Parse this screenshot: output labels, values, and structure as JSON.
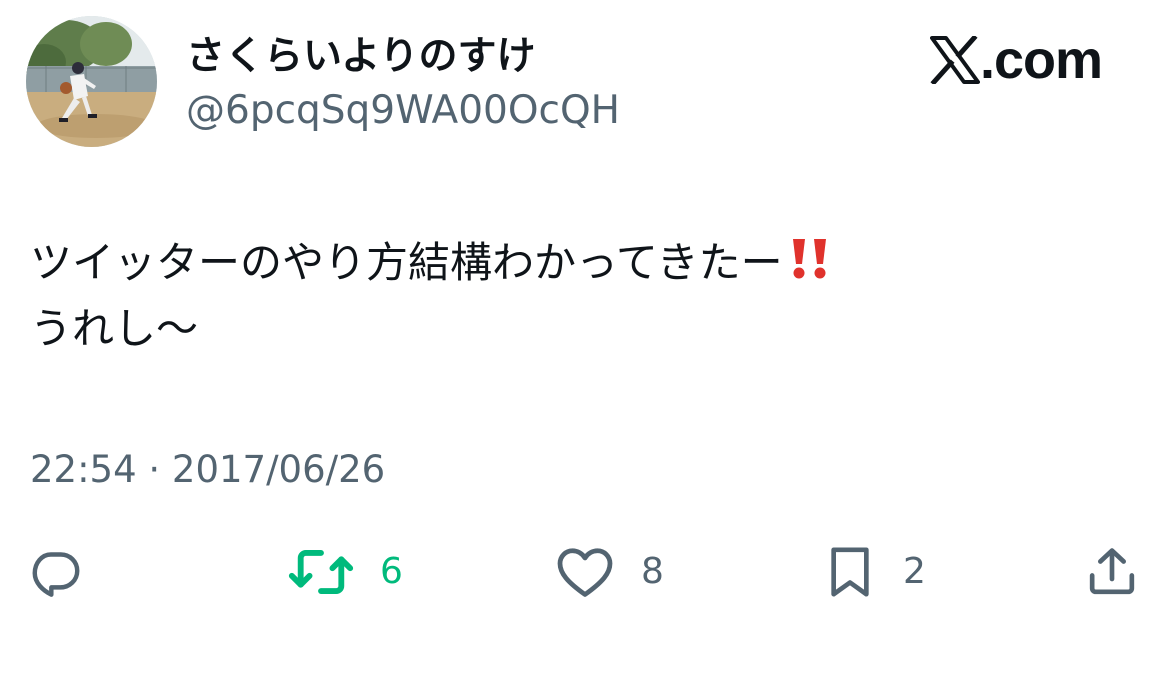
{
  "user": {
    "display_name": "さくらいよりのすけ",
    "handle": "@6pcqSq9WA00OcQH",
    "avatar_icon": "avatar-baseball-pitcher"
  },
  "brand": {
    "text": ".com",
    "icon": "x-logo-icon"
  },
  "tweet": {
    "lines": [
      "ツイッターのやり方結構わかってきたー",
      "うれし〜"
    ],
    "emoji": "double-exclamation-icon",
    "timestamp": "22:54 · 2017/06/26"
  },
  "actions": {
    "reply": {
      "icon": "reply-icon",
      "count": ""
    },
    "retweet": {
      "icon": "retweet-icon",
      "count": "6"
    },
    "like": {
      "icon": "heart-icon",
      "count": "8"
    },
    "bookmark": {
      "icon": "bookmark-icon",
      "count": "2"
    },
    "share": {
      "icon": "share-icon",
      "count": ""
    }
  },
  "colors": {
    "text_primary": "#0f1419",
    "text_secondary": "#536471",
    "retweet_green": "#00ba7c",
    "emoji_red": "#e0322c"
  }
}
